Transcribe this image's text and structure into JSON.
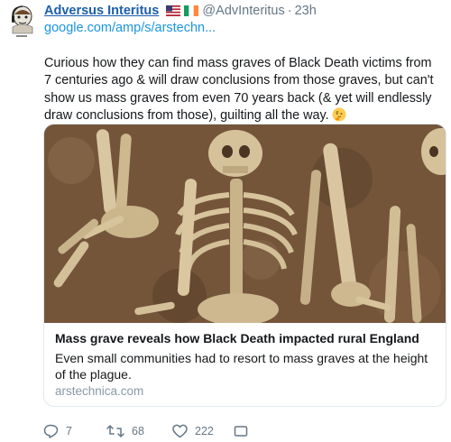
{
  "tweet": {
    "display_name": "Adversus Interitus",
    "handle": "@AdvInteritus",
    "separator": "·",
    "time": "23h",
    "link_text": "google.com/amp/s/arstechn...",
    "text": "Curious how they can find mass graves of Black Death victims from 7 centuries ago & will draw conclusions from those graves, but can't show us mass graves from even 70 years back (& yet will endlessly draw conclusions from those), guilting all the way.",
    "emoji": "thinking-face",
    "flags": [
      "us-flag",
      "ireland-flag"
    ]
  },
  "card": {
    "image_description": "skeletons in mass grave",
    "title": "Mass grave reveals how Black Death impacted rural England",
    "description": "Even small communities had to resort to mass graves at the height of the plague.",
    "domain": "arstechnica.com"
  },
  "actions": {
    "reply_count": "7",
    "retweet_count": "68",
    "like_count": "222"
  },
  "colors": {
    "name": "#1b5fad",
    "link": "#1b95e0",
    "muted": "#657786",
    "border": "#e1e8ed"
  }
}
